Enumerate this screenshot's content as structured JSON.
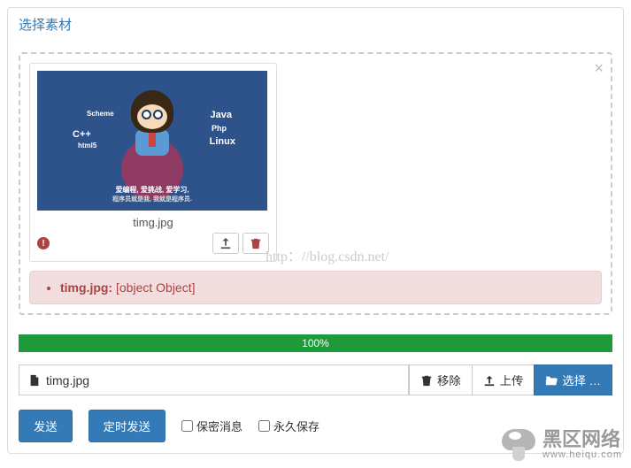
{
  "panel_title": "选择素材",
  "thumbnail": {
    "filename": "timg.jpg",
    "gfx": {
      "java": "Java",
      "php": "Php",
      "linux": "Linux",
      "cpp": "C++",
      "scheme": "Scheme",
      "html5": "html5",
      "tag1": "爱编程, 爱挑战, 爱学习,",
      "tag2": "程序员就是我, 我就是程序员."
    }
  },
  "error": {
    "filename": "timg.jpg:",
    "message": " [object Object]"
  },
  "watermark_url": "http：//blog.csdn.net/",
  "progress": {
    "label": "100%",
    "width": "100%"
  },
  "filebox": {
    "selected": "timg.jpg"
  },
  "buttons": {
    "remove": "移除",
    "upload": "上传",
    "browse": "选择 …",
    "send": "发送",
    "schedule": "定时发送"
  },
  "checkboxes": {
    "secret": "保密消息",
    "permanent": "永久保存"
  },
  "bottom_watermark": {
    "title": "黑区网络",
    "url": "www.heiqu.com"
  }
}
